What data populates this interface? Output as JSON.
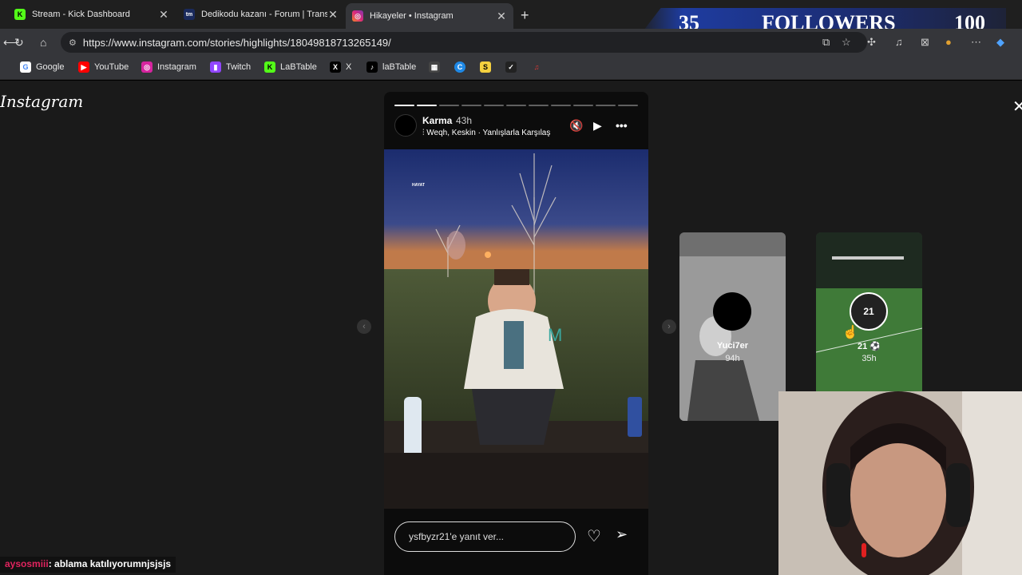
{
  "tabs": [
    {
      "title": "Stream - Kick Dashboard",
      "favicon": "K",
      "color": "#53fc18"
    },
    {
      "title": "Dedikodu kazanı - Forum | Transfe",
      "favicon": "tm",
      "color": "#1a2a5c"
    },
    {
      "title": "Hikayeler • Instagram",
      "favicon": "ig",
      "color": "#d6249f"
    }
  ],
  "overlay": {
    "left_count": "35",
    "label": "FOLLOWERS",
    "right_count": "100"
  },
  "url": "https://www.instagram.com/stories/highlights/18049818713265149/",
  "bookmarks": [
    {
      "label": "Google",
      "icon": "G",
      "color": "#4285f4"
    },
    {
      "label": "YouTube",
      "icon": "▶",
      "color": "#ff0000"
    },
    {
      "label": "Instagram",
      "icon": "◎",
      "color": "#d6249f"
    },
    {
      "label": "Twitch",
      "icon": "▮",
      "color": "#9146ff"
    },
    {
      "label": "LaBTable",
      "icon": "K",
      "color": "#53fc18"
    },
    {
      "label": "X",
      "icon": "X",
      "color": "#000000"
    },
    {
      "label": "laBTable",
      "icon": "♪",
      "color": "#000000"
    }
  ],
  "page": {
    "logo": "Instagram",
    "close_icon": "close-icon"
  },
  "story": {
    "username": "Karma",
    "time": "43h",
    "music": "Weqh, Keskin · Yanlışlarla Karşılaş",
    "photo_text": "HAYAT",
    "reply_placeholder": "ysfbyzr21'e yanıt ver...",
    "segments_total": 11,
    "segments_done": 2
  },
  "thumbs": [
    {
      "name": "Yuci7er",
      "time": "94h"
    },
    {
      "name": "21 ⚽",
      "time": "35h",
      "badge": "21"
    }
  ],
  "chat": {
    "user": "aysosmiii",
    "message": ": ablama katılıyorumnjsjsjs"
  }
}
